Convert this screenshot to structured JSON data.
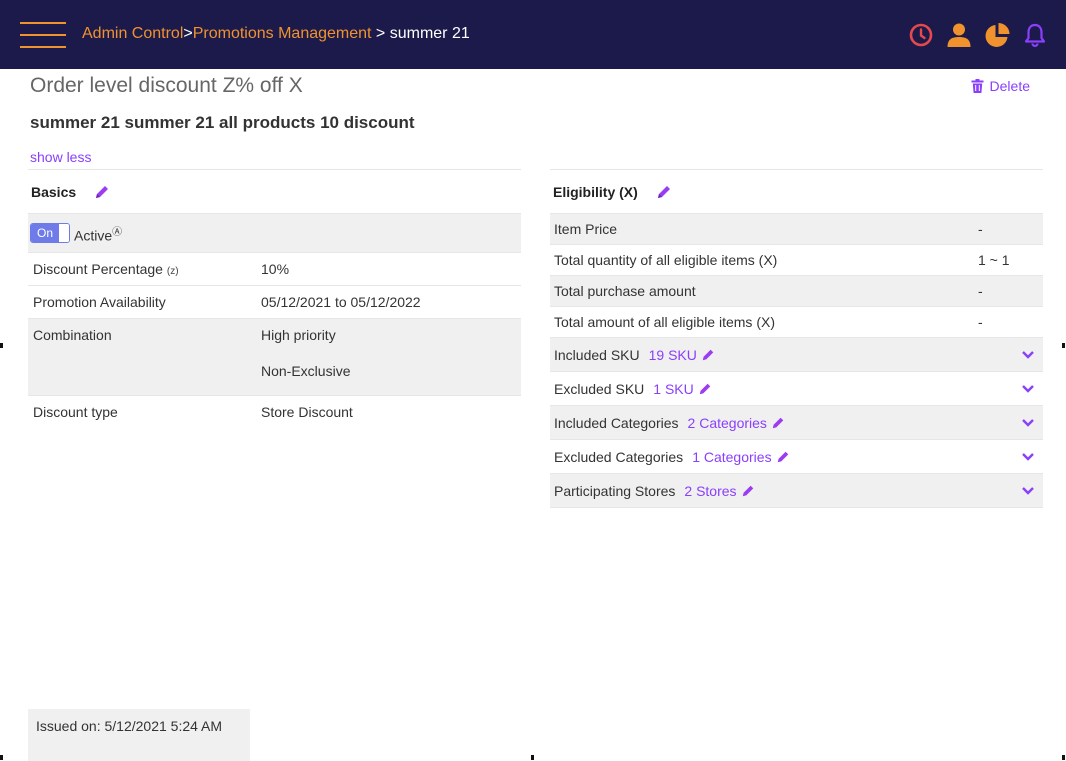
{
  "header": {
    "breadcrumb": {
      "admin": "Admin Control",
      "sep1": ">",
      "promotions": "Promotions Management",
      "sep2": " > ",
      "current": "summer 21"
    },
    "icons": [
      "clock-icon",
      "user-icon",
      "pie-chart-icon",
      "bell-icon"
    ],
    "colors": {
      "bar": "#1c1a4b",
      "link": "#f0922e",
      "clock": "#e5484d",
      "bell": "#8a3ffc"
    }
  },
  "page": {
    "title": "Order level discount Z% off X",
    "delete_label": "Delete",
    "promo_name": "summer 21 summer 21 all products 10 discount",
    "show_less": "show less"
  },
  "basics": {
    "title": "Basics",
    "toggle_on": "On",
    "active_label": "Active",
    "help_mark": "?",
    "rows": [
      {
        "label": "Discount Percentage",
        "label_suffix": "(z)",
        "value": "10%"
      },
      {
        "label": "Promotion Availability",
        "value": "05/12/2021 to 05/12/2022"
      },
      {
        "label": "Combination",
        "values": [
          "High priority",
          "Non-Exclusive"
        ]
      },
      {
        "label": "Discount type",
        "value": "Store Discount"
      }
    ]
  },
  "eligibility": {
    "title": "Eligibility (X)",
    "rows": [
      {
        "label": "Item Price",
        "value": "-"
      },
      {
        "label": "Total quantity of all eligible items (X)",
        "value": "1 ~ 1"
      },
      {
        "label": "Total purchase amount",
        "value": "-"
      },
      {
        "label": "Total amount of all eligible items (X)",
        "value": "-"
      }
    ],
    "expandables": [
      {
        "label": "Included SKU",
        "link": "19 SKU"
      },
      {
        "label": "Excluded SKU",
        "link": "1 SKU"
      },
      {
        "label": "Included Categories",
        "link": "2 Categories"
      },
      {
        "label": "Excluded Categories",
        "link": "1 Categories"
      },
      {
        "label": "Participating Stores",
        "link": "2 Stores"
      }
    ]
  },
  "footer": {
    "issued": "Issued on: 5/12/2021 5:24 AM"
  }
}
